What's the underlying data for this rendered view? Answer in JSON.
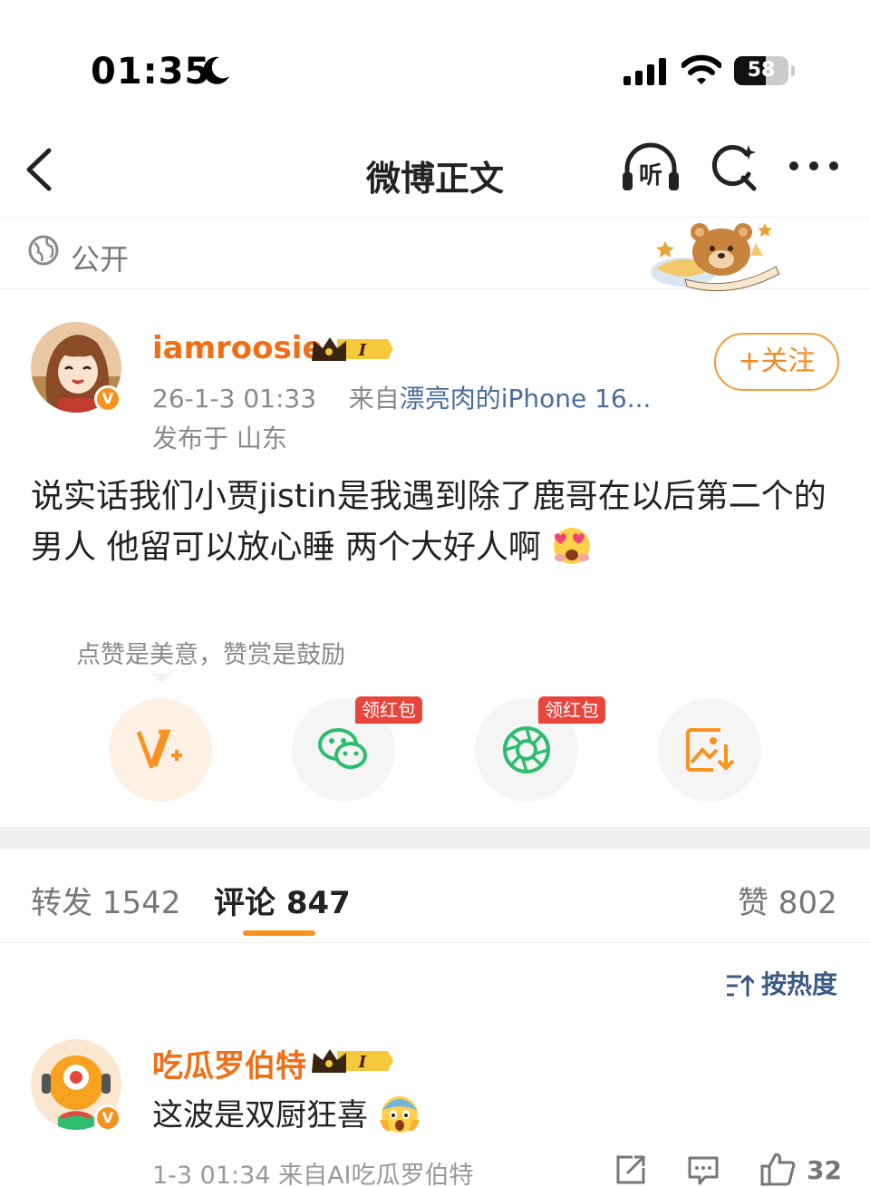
{
  "status_bar": {
    "time": "01:35",
    "battery": "58",
    "battery_level": 0.58
  },
  "nav": {
    "title": "微博正文",
    "listen_label": "听"
  },
  "visibility": {
    "label": "公开"
  },
  "post": {
    "username": "iamroosie",
    "vip_level": "I",
    "time": "26-1-3 01:33",
    "source_prefix": "来自",
    "source": "漂亮肉的iPhone 16...",
    "location": "发布于 山东",
    "follow_label": "+关注",
    "text": "说实话我们小贾jistin是我遇到除了鹿哥在以后第二个的男人 他留可以放心睡 两个大好人啊"
  },
  "reward": {
    "tip": "点赞是美意，赞赏是鼓励",
    "red_packet_label": "领红包"
  },
  "tabs": [
    {
      "label": "转发 1542"
    },
    {
      "label": "评论 847"
    },
    {
      "label": "赞 802"
    }
  ],
  "sort": {
    "label": "按热度"
  },
  "comment": {
    "username": "吃瓜罗伯特",
    "vip_level": "I",
    "text": "这波是双厨狂喜",
    "meta": "1-3 01:34  来自AI吃瓜罗伯特",
    "likes": "32"
  },
  "colors": {
    "accent": "#f7931e",
    "username": "#f26e16",
    "link": "#4a6c9b",
    "red_tag": "#e8453c"
  },
  "icons": [
    "moon-icon",
    "signal-icon",
    "wifi-icon",
    "back-arrow-icon",
    "listen-icon",
    "search-icon",
    "more-icon",
    "globe-icon",
    "vip-crown-icon",
    "verified-icon",
    "reward-v-icon",
    "wechat-icon",
    "moments-icon",
    "save-image-icon",
    "sort-icon",
    "share-icon",
    "comment-icon",
    "like-icon"
  ]
}
